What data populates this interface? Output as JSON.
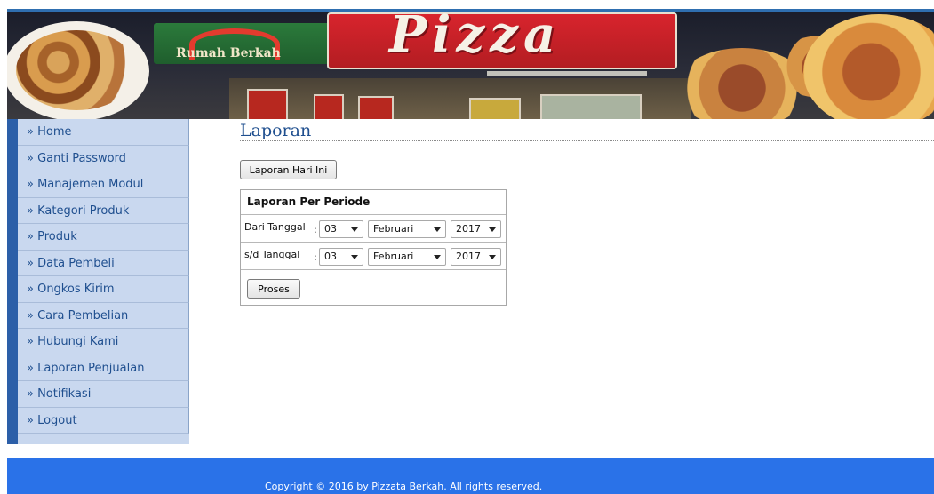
{
  "banner": {
    "brand_text": "Pizza",
    "sub_label": "Rumah Berkah"
  },
  "sidebar": {
    "items": [
      {
        "label": "» Home"
      },
      {
        "label": "» Ganti Password"
      },
      {
        "label": "» Manajemen Modul"
      },
      {
        "label": "» Kategori Produk"
      },
      {
        "label": "» Produk"
      },
      {
        "label": "» Data Pembeli"
      },
      {
        "label": "» Ongkos Kirim"
      },
      {
        "label": "» Cara Pembelian"
      },
      {
        "label": "» Hubungi Kami"
      },
      {
        "label": "» Laporan Penjualan"
      },
      {
        "label": "» Notifikasi"
      },
      {
        "label": "» Logout"
      }
    ]
  },
  "main": {
    "title": "Laporan",
    "today_button": "Laporan Hari Ini",
    "period": {
      "heading": "Laporan Per Periode",
      "colon": ":",
      "from_label": "Dari Tanggal",
      "to_label": "s/d Tanggal",
      "from": {
        "day": "03",
        "month": "Februari",
        "year": "2017"
      },
      "to": {
        "day": "03",
        "month": "Februari",
        "year": "2017"
      },
      "process_button": "Proses"
    }
  },
  "footer": {
    "copyright": "Copyright © 2016 by Pizzata Berkah. All rights reserved."
  },
  "colors": {
    "sidebar_bg": "#c9d8ef",
    "sidebar_text": "#1f4f8f",
    "sidebar_accent": "#2c5fa8",
    "footer_bg": "#2a72e8",
    "title_color": "#1f4f8f"
  }
}
